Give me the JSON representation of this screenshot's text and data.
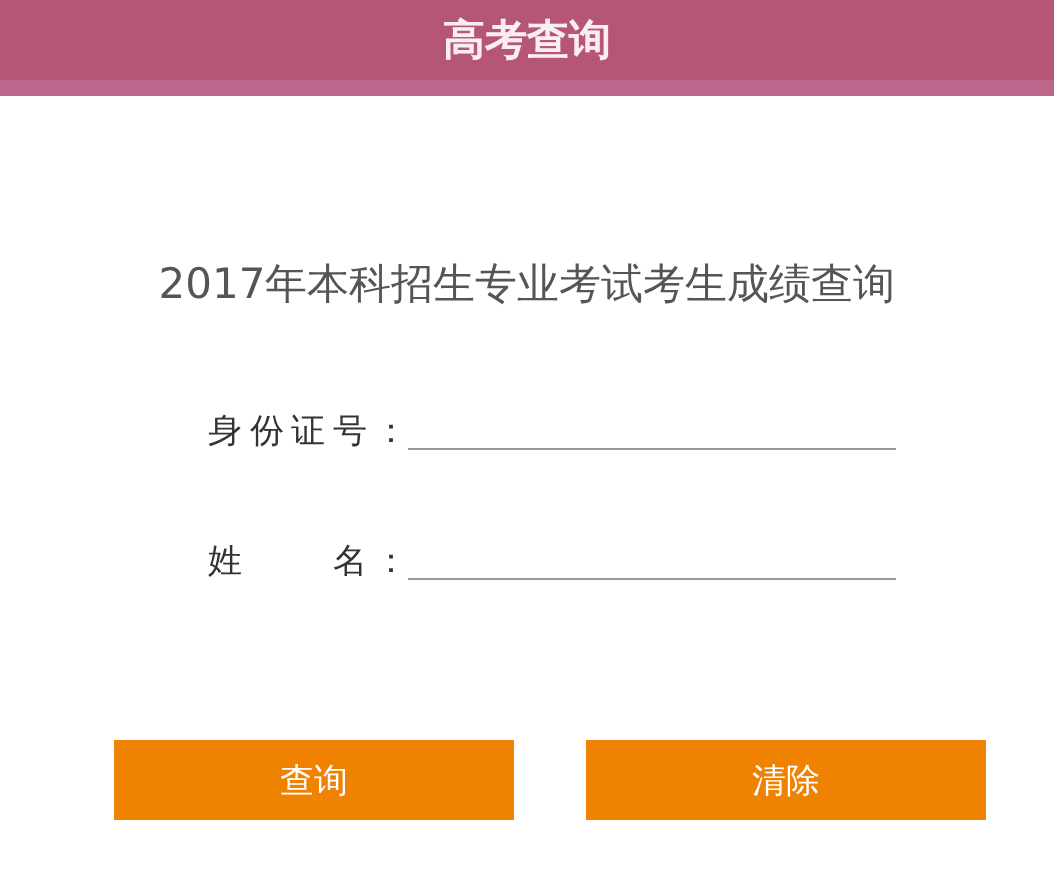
{
  "header": {
    "title": "高考查询"
  },
  "heading": "2017年本科招生专业考试考生成绩查询",
  "fields": [
    {
      "label": "身份证号："
    },
    {
      "label": "姓　　名："
    }
  ],
  "buttons": [
    "查询",
    "清除"
  ]
}
